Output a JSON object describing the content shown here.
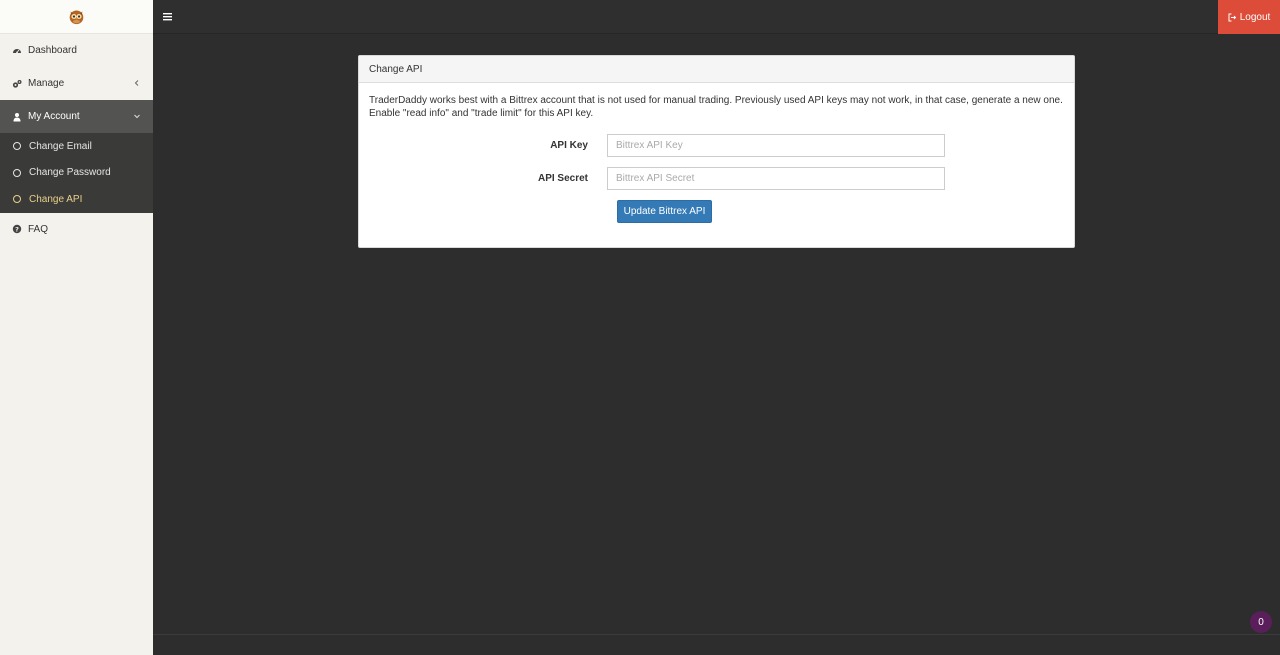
{
  "sidebar": {
    "items": [
      {
        "label": "Dashboard",
        "icon": "dashboard-icon"
      },
      {
        "label": "Manage",
        "icon": "cogs-icon"
      },
      {
        "label": "My Account",
        "icon": "user-icon"
      },
      {
        "label": "FAQ",
        "icon": "question-circle-icon"
      }
    ],
    "subitems": [
      {
        "label": "Change Email"
      },
      {
        "label": "Change Password"
      },
      {
        "label": "Change API"
      }
    ]
  },
  "topbar": {
    "logout_label": "Logout"
  },
  "panel": {
    "title": "Change API",
    "description": "TraderDaddy works best with a Bittrex account that is not used for manual trading. Previously used API keys may not work, in that case, generate a new one. Enable \"read info\" and \"trade limit\" for this API key.",
    "api_key_label": "API Key",
    "api_key_placeholder": "Bittrex API Key",
    "api_key_value": "",
    "api_secret_label": "API Secret",
    "api_secret_placeholder": "Bittrex API Secret",
    "api_secret_value": "",
    "submit_label": "Update Bittrex API"
  },
  "badge": {
    "count": "0"
  },
  "colors": {
    "logout": "#dd4b39",
    "primary": "#337ab7",
    "active_submenu": "#e9d08a",
    "badge": "#5a1f5a"
  }
}
